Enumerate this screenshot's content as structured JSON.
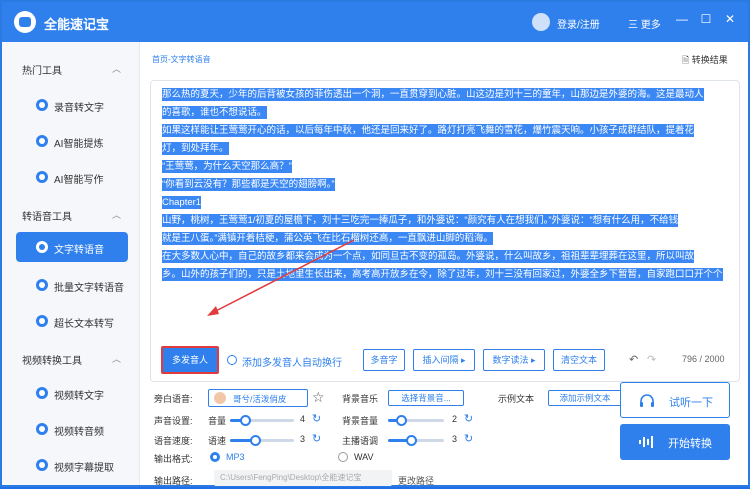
{
  "window": {
    "app_title": "全能速记宝",
    "login_label": "登录/注册",
    "more_label": "三 更多",
    "minimize": "—",
    "maximize": "☐",
    "close": "✕"
  },
  "sidebar": {
    "sections": [
      {
        "title": "热门工具",
        "items": [
          "录音转文字",
          "AI智能提炼",
          "AI智能写作"
        ]
      },
      {
        "title": "转语音工具",
        "items": [
          "文字转语音",
          "批量文字转语音",
          "超长文本转写"
        ]
      },
      {
        "title": "视频转换工具",
        "items": [
          "视频转文字",
          "视频转音频",
          "视频字幕提取"
        ]
      }
    ],
    "active_item": "文字转语音"
  },
  "main": {
    "breadcrumb": "首页-文字转语音",
    "convert_result": "转换结果",
    "text_lines": [
      "那么热的夏天，少年的后背被女孩的菲伤透出一个洞，一直贯穿到心脏。山这边是刘十三的童年，山那边是外婆的海。这是最动人",
      "的喜歌，谁也不想说话。",
      "如果这样能让王莺莺开心的话，以后每年中秋，他还是回来好了。路灯打亮飞舞的雪花，爆竹震天响。小孩子成群结队，提着花",
      "灯，到处拜年。",
      "“王莺莺，为什么天空那么高？”",
      "“你看到云没有？那些都是天空的翅膀啊。”",
      "Chapter1",
      "山野，桃树，王莺莺1/初夏的屋檐下，刘十三吃完一捧瓜子，和外婆说：“颜究有人在想我们。”外婆说：“想有什么用，不给钱",
      "就是王八蛋。”满镇开着桔梗，蒲公英飞在比石榴树还高，一直飘进山脚的稻海。",
      "在大多数人心中，自己的故乡都来会成为一个点，如同旦古不变的孤岛。外婆说，什么叫故乡，祖祖辈辈埋葬在这里，所以叫故",
      "乡。山外的孩子们的，只是土地里生长出来，高考高开放乡在令，除了过年，刘十三没有回家过，外婆全乡下暂暂，自家跑口口开个个"
    ],
    "toolbar": {
      "multi_tone": "多发音人",
      "add_auto_wrap": "添加多发音人自动换行",
      "polyphone": "多音字",
      "insert_pause": "插入间隔 ▸",
      "digit_read": "数字读法 ▸",
      "clear_text": "清空文本",
      "undo": "↶",
      "redo": "↷",
      "counter": "796 / 2000"
    }
  },
  "settings": {
    "voice_label": "旁白语音:",
    "voice_value": "哥兮/活泼俏皮",
    "bgm_label": "背景音乐",
    "bgm_button": "选择背景音...",
    "sample_label": "示例文本",
    "sample_button": "添加示例文本",
    "volume_section": "声音设置:",
    "volume_label": "音量",
    "volume_value": "4",
    "bg_volume_label": "背景音量",
    "bg_volume_value": "2",
    "speed_section": "语音速度:",
    "speed_label": "语速",
    "speed_value": "3",
    "tone_label": "主播语调",
    "tone_value": "3",
    "format_label": "输出格式:",
    "format_mp3": "MP3",
    "format_wav": "WAV",
    "path_label": "输出路径:",
    "path_value": "C:\\Users\\FengPing\\Desktop\\全能速记宝",
    "change_path": "更改路径",
    "refresh_icon": "↻",
    "star_icon": "☆"
  },
  "actions": {
    "preview": "试听一下",
    "start": "开始转换"
  },
  "colors": {
    "accent": "#2f80ed",
    "highlight": "#3b88f5",
    "annotation": "#e23b3b"
  }
}
